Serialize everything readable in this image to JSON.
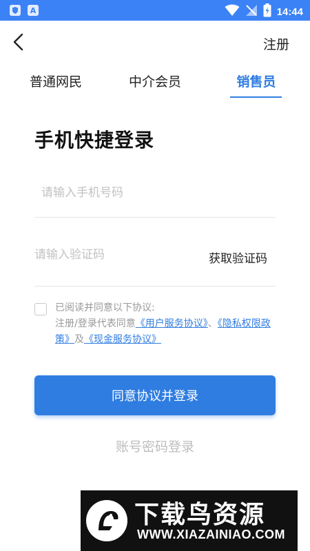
{
  "status_bar": {
    "time": "14:44",
    "left_icons": [
      "shield-icon",
      "a-badge-icon"
    ],
    "right_icons": [
      "wifi-icon",
      "no-signal-icon",
      "battery-icon"
    ]
  },
  "header": {
    "back_icon": "chevron-left-icon",
    "register_label": "注册"
  },
  "tabs": [
    {
      "label": "普通网民",
      "active": false
    },
    {
      "label": "中介会员",
      "active": false
    },
    {
      "label": "销售员",
      "active": true
    }
  ],
  "title": "手机快捷登录",
  "phone": {
    "placeholder": "请输入手机号码",
    "value": ""
  },
  "code": {
    "placeholder": "请输入验证码",
    "value": "",
    "get_code_label": "获取验证码"
  },
  "agreement": {
    "checked": false,
    "line1": "已阅读并同意以下协议:",
    "prefix": "注册/登录代表同意",
    "user_agreement": "《用户服务协议》",
    "sep1": "、",
    "privacy": "《隐私权限政策》",
    "sep2": "及",
    "cash_agreement": "《现金服务协议》"
  },
  "login_button": "同意协议并登录",
  "password_login": "账号密码登录",
  "watermark": {
    "title": "下载鸟资源",
    "url": "WWW.XIAZAINIAO.COM"
  },
  "colors": {
    "accent": "#2f7de1",
    "status_bar": "#3b82f6",
    "placeholder": "#c2c2c2"
  }
}
